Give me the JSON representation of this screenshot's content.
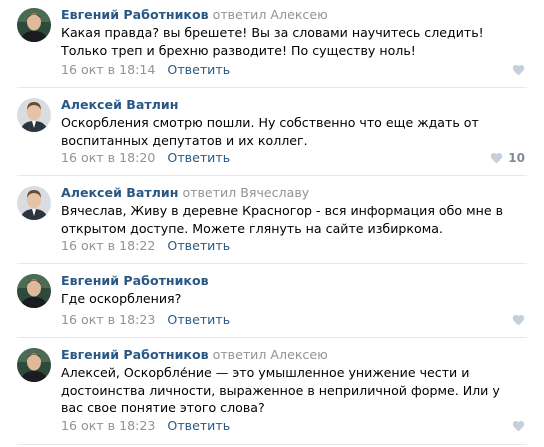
{
  "comments": [
    {
      "author": "Евгений Работников",
      "reply_to": "ответил Алексею",
      "text": "Какая правда? вы брешете! Вы за словами научитесь следить! Только треп и брехню разводите! По существу ноль!",
      "date": "16 окт в 18:14",
      "reply_label": "Ответить",
      "likes": ""
    },
    {
      "author": "Алексей Ватлин",
      "reply_to": "",
      "text": "Оскорбления смотрю пошли. Ну собственно что еще ждать от воспитанных депутатов и их коллег.",
      "date": "16 окт в 18:20",
      "reply_label": "Ответить",
      "likes": "10"
    },
    {
      "author": "Алексей Ватлин",
      "reply_to": "ответил Вячеславу",
      "text": "Вячеслав, Живу в деревне Красногор - вся информация обо мне в открытом доступе. Можете глянуть на сайте избиркома.",
      "date": "16 окт в 18:22",
      "reply_label": "Ответить",
      "likes": ""
    },
    {
      "author": "Евгений Работников",
      "reply_to": "",
      "text": "Где оскорбления?",
      "date": "16 окт в 18:23",
      "reply_label": "Ответить",
      "likes": ""
    },
    {
      "author": "Евгений Работников",
      "reply_to": "ответил Алексею",
      "text": "Алексей, Оскорбле́ние — это умышленное унижение чести и достоинства личности, выраженное в неприличной форме. Или у вас свое понятие этого слова?",
      "date": "16 окт в 18:23",
      "reply_label": "Ответить",
      "likes": ""
    }
  ],
  "colors": {
    "link": "#2a5885",
    "muted": "#939393",
    "heart": "#c5d0db",
    "divider": "#e7e8ec"
  }
}
